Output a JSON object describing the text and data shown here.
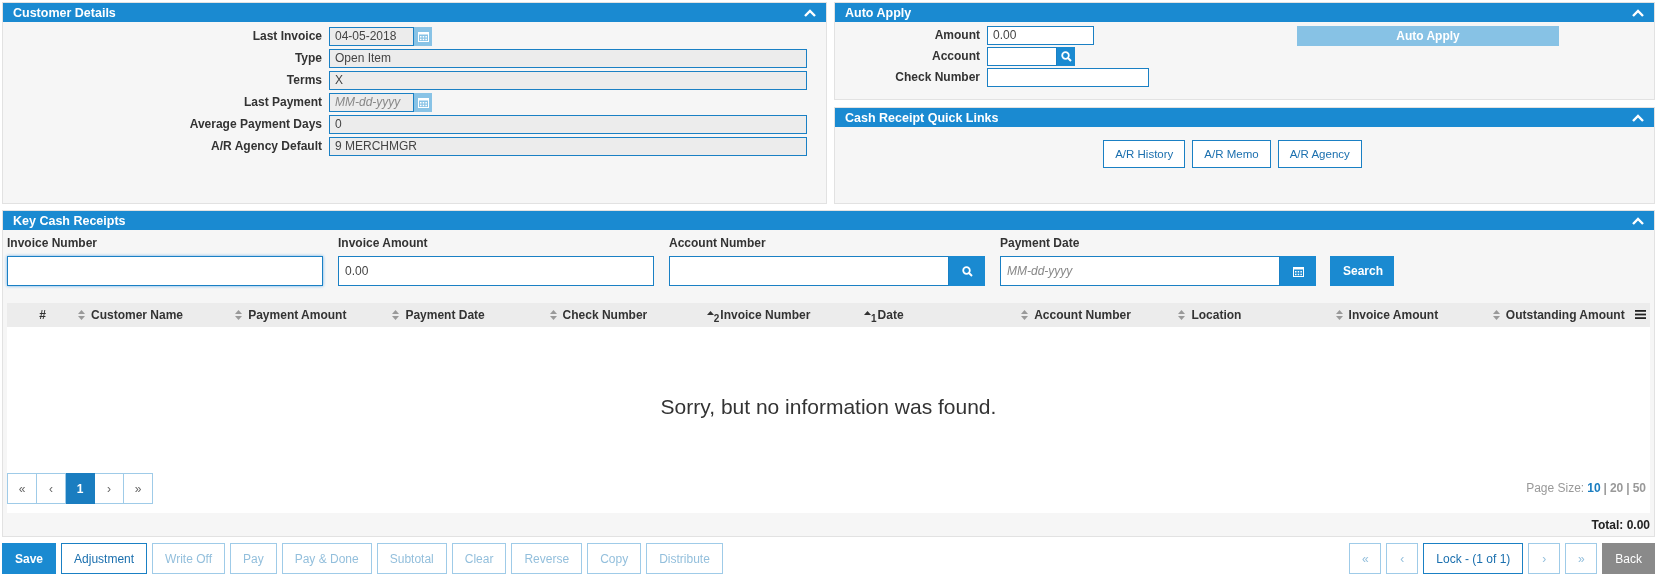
{
  "customer_details": {
    "title": "Customer Details",
    "fields": [
      {
        "label": "Last Invoice",
        "kind": "date",
        "readonly": true,
        "value": "04-05-2018"
      },
      {
        "label": "Type",
        "kind": "text",
        "readonly": true,
        "value": "Open Item"
      },
      {
        "label": "Terms",
        "kind": "text",
        "readonly": true,
        "value": "X"
      },
      {
        "label": "Last Payment",
        "kind": "date",
        "readonly": true,
        "placeholder": "MM-dd-yyyy"
      },
      {
        "label": "Average Payment Days",
        "kind": "text",
        "readonly": true,
        "value": "0"
      },
      {
        "label": "A/R Agency Default",
        "kind": "text",
        "readonly": true,
        "value": "9 MERCHMGR"
      }
    ]
  },
  "auto_apply": {
    "title": "Auto Apply",
    "fields": [
      {
        "label": "Amount",
        "kind": "text",
        "readonly": false,
        "value": "0.00"
      },
      {
        "label": "Account",
        "kind": "lookup",
        "readonly": false
      },
      {
        "label": "Check Number",
        "kind": "text",
        "readonly": false
      }
    ],
    "button": {
      "label": "Auto Apply",
      "disabled": true
    }
  },
  "quick_links": {
    "title": "Cash Receipt Quick Links",
    "links": [
      "A/R History",
      "A/R Memo",
      "A/R Agency"
    ]
  },
  "key_cash_receipts": {
    "title": "Key Cash Receipts",
    "filters": [
      {
        "label": "Invoice Number",
        "kind": "text",
        "focused": true
      },
      {
        "label": "Invoice Amount",
        "kind": "text",
        "focused": false,
        "value": "0.00"
      },
      {
        "label": "Account Number",
        "kind": "lookup",
        "focused": false
      },
      {
        "label": "Payment Date",
        "kind": "date",
        "focused": false,
        "placeholder": "MM-dd-yyyy"
      }
    ],
    "search_button": "Search",
    "table": {
      "columns": [
        {
          "label": "#",
          "kind": "plain"
        },
        {
          "label": "Customer Name",
          "kind": "sortable"
        },
        {
          "label": "Payment Amount",
          "kind": "sortable"
        },
        {
          "label": "Payment Date",
          "kind": "sortable"
        },
        {
          "label": "Check Number",
          "kind": "sortable"
        },
        {
          "label": "Invoice Number",
          "kind": "sorted",
          "sort_order": "2"
        },
        {
          "label": "Date",
          "kind": "sorted",
          "sort_order": "1"
        },
        {
          "label": "Account Number",
          "kind": "sortable"
        },
        {
          "label": "Location",
          "kind": "sortable"
        },
        {
          "label": "Invoice Amount",
          "kind": "sortable"
        },
        {
          "label": "Outstanding Amount",
          "kind": "sortable"
        }
      ],
      "empty_message": "Sorry, but no information was found."
    },
    "pagination": [
      {
        "label": "«",
        "selected": false
      },
      {
        "label": "‹",
        "selected": false
      },
      {
        "label": "1",
        "selected": true
      },
      {
        "label": "›",
        "selected": false
      },
      {
        "label": "»",
        "selected": false
      }
    ],
    "page_size": {
      "label": "Page Size:",
      "options": [
        {
          "label": "10",
          "selected": true
        },
        {
          "label": "20",
          "selected": false
        },
        {
          "label": "50",
          "selected": false
        }
      ],
      "separators": [
        "|",
        "|"
      ]
    },
    "total": "Total: 0.00"
  },
  "actions": [
    {
      "label": "Save",
      "kind": "primary",
      "disabled": false
    },
    {
      "label": "Adjustment",
      "kind": "outline",
      "disabled": false
    },
    {
      "label": "Write Off",
      "kind": "outline",
      "disabled": true
    },
    {
      "label": "Pay",
      "kind": "outline",
      "disabled": true
    },
    {
      "label": "Pay & Done",
      "kind": "outline",
      "disabled": true
    },
    {
      "label": "Subtotal",
      "kind": "outline",
      "disabled": true
    },
    {
      "label": "Clear",
      "kind": "outline",
      "disabled": true
    },
    {
      "label": "Reverse",
      "kind": "outline",
      "disabled": true
    },
    {
      "label": "Copy",
      "kind": "outline",
      "disabled": true
    },
    {
      "label": "Distribute",
      "kind": "outline",
      "disabled": true
    }
  ],
  "navigation": [
    {
      "label": "«",
      "kind": "outline",
      "disabled": true
    },
    {
      "label": "‹",
      "kind": "outline",
      "disabled": true
    },
    {
      "label": "Lock - (1 of 1)",
      "kind": "outline",
      "disabled": false
    },
    {
      "label": "›",
      "kind": "outline",
      "disabled": true
    },
    {
      "label": "»",
      "kind": "outline",
      "disabled": true
    },
    {
      "label": "Back",
      "kind": "neutral",
      "disabled": false
    }
  ]
}
